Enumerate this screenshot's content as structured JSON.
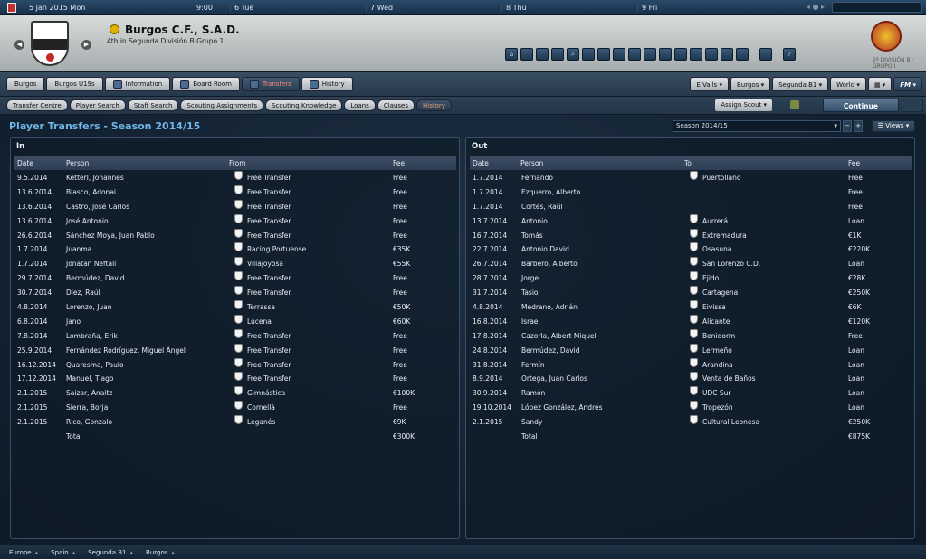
{
  "topbar": {
    "date": "5 Jan 2015  Mon",
    "time": "9:00",
    "days": [
      "6 Tue",
      "7 Wed",
      "8 Thu",
      "9 Fri"
    ]
  },
  "club": {
    "name": "Burgos C.F., S.A.D.",
    "subtitle": "4th in Segunda División B Grupo 1"
  },
  "tabs": [
    {
      "label": "Burgos",
      "active": false
    },
    {
      "label": "Burgos U19s",
      "active": false
    },
    {
      "label": "Information",
      "active": false
    },
    {
      "label": "Board Room",
      "active": false
    },
    {
      "label": "Transfers",
      "active": true
    },
    {
      "label": "History",
      "active": false
    }
  ],
  "right_menus": [
    "E Valls",
    "Burgos",
    "Segunda B1",
    "World",
    "FM"
  ],
  "subtabs": [
    {
      "label": "Transfer Centre",
      "active": false
    },
    {
      "label": "Player Search",
      "active": false
    },
    {
      "label": "Staff Search",
      "active": false
    },
    {
      "label": "Scouting Assignments",
      "active": false
    },
    {
      "label": "Scouting Knowledge",
      "active": false
    },
    {
      "label": "Loans",
      "active": false
    },
    {
      "label": "Clauses",
      "active": false
    },
    {
      "label": "History",
      "active": true
    }
  ],
  "assign_scout": "Assign Scout",
  "continue_label": "Continue",
  "page_title": "Player Transfers - Season 2014/15",
  "season_select": "Season 2014/15",
  "views_label": "Views",
  "in_panel": {
    "title": "In",
    "headers": [
      "Date",
      "Person",
      "From",
      "Fee"
    ],
    "rows": [
      [
        "9.5.2014",
        "Ketterl, Johannes",
        "Free Transfer",
        "Free"
      ],
      [
        "13.6.2014",
        "Blasco, Adonai",
        "Free Transfer",
        "Free"
      ],
      [
        "13.6.2014",
        "Castro, José Carlos",
        "Free Transfer",
        "Free"
      ],
      [
        "13.6.2014",
        "José Antonio",
        "Free Transfer",
        "Free"
      ],
      [
        "26.6.2014",
        "Sánchez Moya, Juan Pablo",
        "Free Transfer",
        "Free"
      ],
      [
        "1.7.2014",
        "Juanma",
        "Racing Portuense",
        "€35K"
      ],
      [
        "1.7.2014",
        "Jonatan Neftalí",
        "Villajoyosa",
        "€55K"
      ],
      [
        "29.7.2014",
        "Bermúdez, David",
        "Free Transfer",
        "Free"
      ],
      [
        "30.7.2014",
        "Díez, Raúl",
        "Free Transfer",
        "Free"
      ],
      [
        "4.8.2014",
        "Lorenzo, Juan",
        "Terrassa",
        "€50K"
      ],
      [
        "6.8.2014",
        "Jano",
        "Lucena",
        "€60K"
      ],
      [
        "7.8.2014",
        "Lombraña, Erik",
        "Free Transfer",
        "Free"
      ],
      [
        "25.9.2014",
        "Fernández Rodríguez, Miguel Ángel",
        "Free Transfer",
        "Free"
      ],
      [
        "16.12.2014",
        "Quaresma, Paulo",
        "Free Transfer",
        "Free"
      ],
      [
        "17.12.2014",
        "Manuel, Tiago",
        "Free Transfer",
        "Free"
      ],
      [
        "2.1.2015",
        "Saizar, Anaitz",
        "Gimnástica",
        "€100K"
      ],
      [
        "2.1.2015",
        "Sierra, Borja",
        "Cornellà",
        "Free"
      ],
      [
        "2.1.2015",
        "Rico, Gonzalo",
        "Leganés",
        "€9K"
      ]
    ],
    "total_label": "Total",
    "total_value": "€300K"
  },
  "out_panel": {
    "title": "Out",
    "headers": [
      "Date",
      "Person",
      "To",
      "Fee"
    ],
    "rows": [
      [
        "1.7.2014",
        "Fernando",
        "Puertollano",
        "Free"
      ],
      [
        "1.7.2014",
        "Ezquerro, Alberto",
        "",
        "Free"
      ],
      [
        "1.7.2014",
        "Cortés, Raúl",
        "",
        "Free"
      ],
      [
        "13.7.2014",
        "Antonio",
        "Aurrerá",
        "Loan"
      ],
      [
        "16.7.2014",
        "Tomás",
        "Extremadura",
        "€1K"
      ],
      [
        "22.7.2014",
        "Antonio David",
        "Osasuna",
        "€220K"
      ],
      [
        "26.7.2014",
        "Barbero, Alberto",
        "San Lorenzo C.D.",
        "Loan"
      ],
      [
        "28.7.2014",
        "Jorge",
        "Ejido",
        "€28K"
      ],
      [
        "31.7.2014",
        "Tasio",
        "Cartagena",
        "€250K"
      ],
      [
        "4.8.2014",
        "Medrano, Adrián",
        "Eivissa",
        "€6K"
      ],
      [
        "16.8.2014",
        "Israel",
        "Alicante",
        "€120K"
      ],
      [
        "17.8.2014",
        "Cazorla, Albert Miquel",
        "Benidorm",
        "Free"
      ],
      [
        "24.8.2014",
        "Bermúdez, David",
        "Lermeño",
        "Loan"
      ],
      [
        "31.8.2014",
        "Fermín",
        "Arandina",
        "Loan"
      ],
      [
        "8.9.2014",
        "Ortega, Juan Carlos",
        "Venta de Baños",
        "Loan"
      ],
      [
        "30.9.2014",
        "Ramón",
        "UDC Sur",
        "Loan"
      ],
      [
        "19.10.2014",
        "López González, Andrés",
        "Tropezón",
        "Loan"
      ],
      [
        "2.1.2015",
        "Sandy",
        "Cultural Leonesa",
        "€250K"
      ]
    ],
    "total_label": "Total",
    "total_value": "€875K"
  },
  "footer": [
    "Europe",
    "Spain",
    "Segunda B1",
    "Burgos"
  ]
}
